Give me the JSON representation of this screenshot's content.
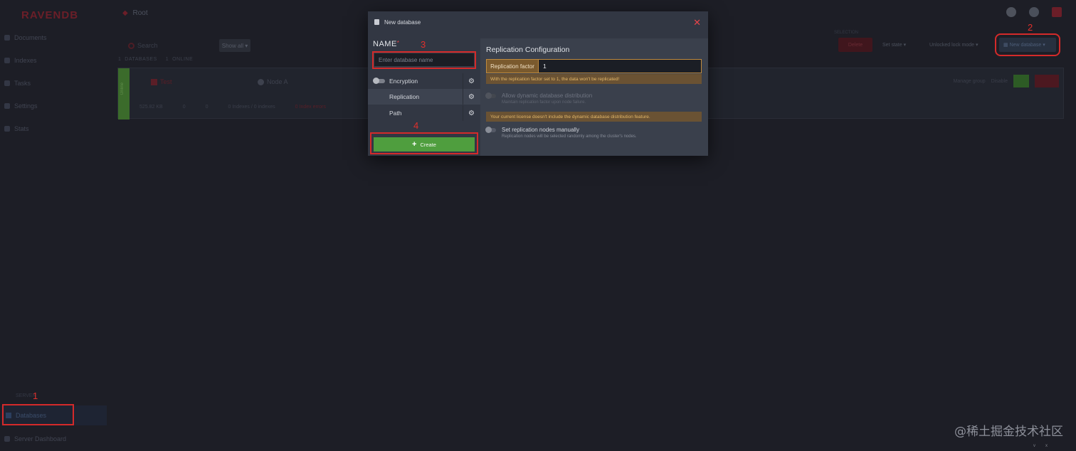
{
  "app": {
    "logo": "RAVENDB",
    "breadcrumb": "Root",
    "nav": {
      "documents": "Documents",
      "indexes": "Indexes",
      "tasks": "Tasks",
      "settings": "Settings",
      "stats": "Stats",
      "server": "SERVER",
      "databases": "Databases",
      "server_dashboard": "Server Dashboard"
    },
    "toolbar": {
      "search_placeholder": "Search",
      "show_all": "Show all",
      "selection_label": "SELECTION",
      "delete": "Delete",
      "set_state": "Set state",
      "manage": "Unlocked lock mode",
      "new_database": "New database"
    },
    "db_counts": {
      "databases_count": "1",
      "databases_label": "DATABASES",
      "online_count": "1",
      "online_label": "ONLINE"
    },
    "db_card": {
      "status": "Online",
      "name": "Test",
      "node": "Node A",
      "size": "525.82 KB",
      "docs": "0",
      "indexing": "0",
      "indexes_label": "0 Indexes / 0 indexes",
      "errors": "0 Index errors",
      "manage_group": "Manage group",
      "disable": "Disable"
    }
  },
  "modal": {
    "title": "New database",
    "name_label": "NAME",
    "name_required": "*",
    "name_placeholder": "Enter database name",
    "options": [
      {
        "label": "Encryption"
      },
      {
        "label": "Replication"
      },
      {
        "label": "Path"
      }
    ],
    "create_label": "Create",
    "replication": {
      "title": "Replication Configuration",
      "factor_label": "Replication factor",
      "factor_value": "1",
      "factor_warning": "With the replication factor set to 1, the data won't be replicated!",
      "dynamic_title": "Allow dynamic database distribution",
      "dynamic_desc": "Maintain replication factor upon node failure.",
      "license_warning": "Your current license doesn't include the dynamic database distribution feature.",
      "manual_title": "Set replication nodes manually",
      "manual_desc": "Replication nodes will be selected randomly among the cluster's nodes."
    }
  },
  "annotations": {
    "n1": "1",
    "n2": "2",
    "n3": "3",
    "n4": "4"
  },
  "watermark": "@稀土掘金技术社区",
  "status_bar": {
    "version": "v",
    "sep": "x"
  },
  "colors": {
    "accent_red": "#d42a2a",
    "create_green": "#4f9e3e",
    "warning_orange": "#c08b3e"
  }
}
